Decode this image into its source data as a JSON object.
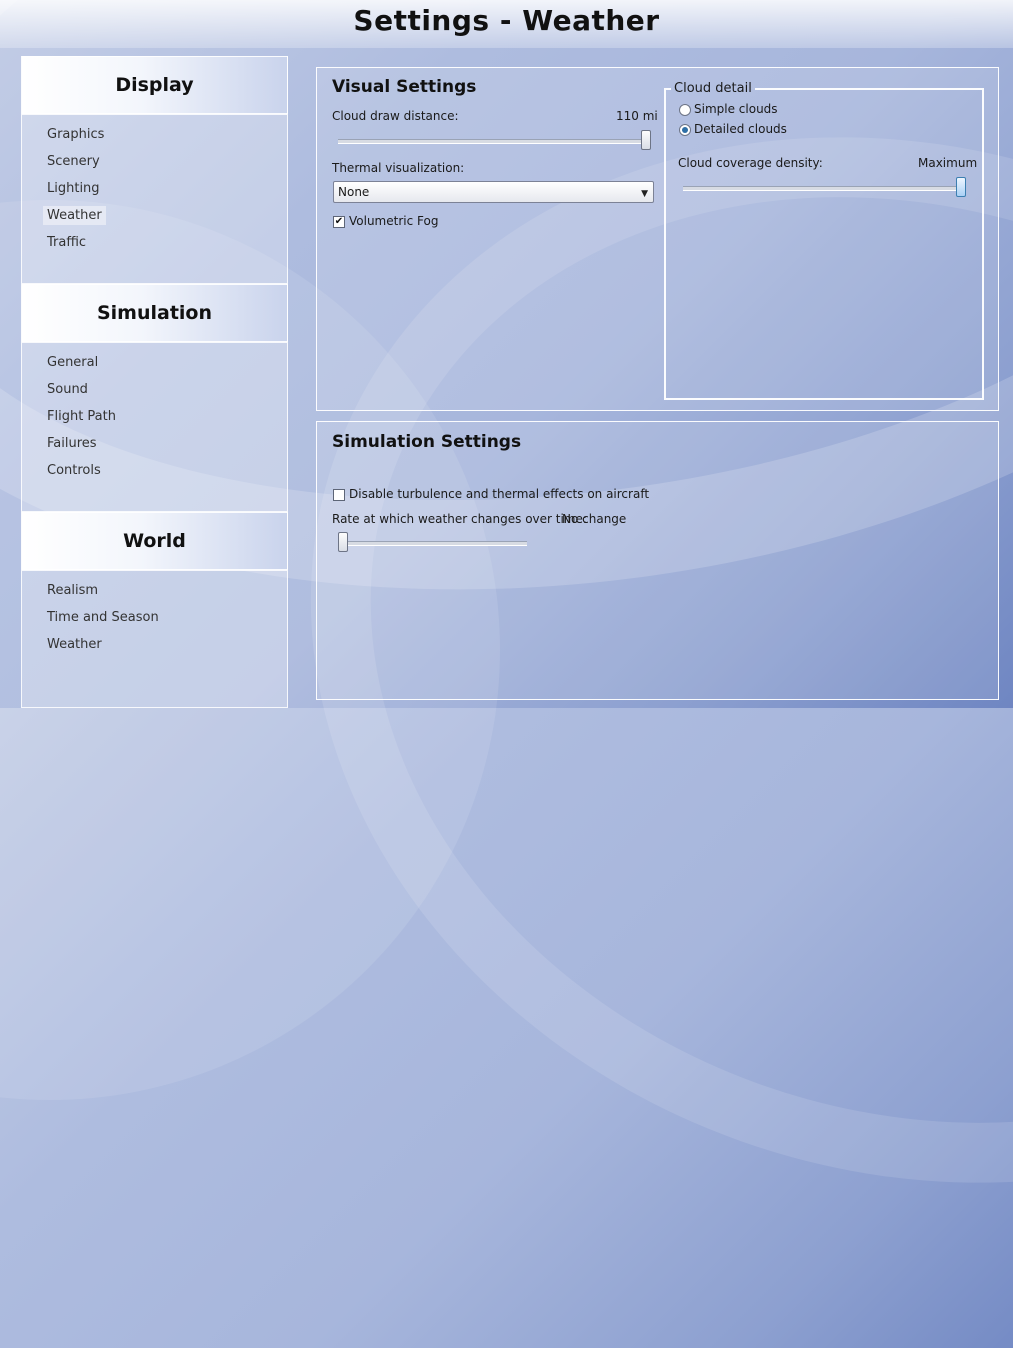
{
  "page": {
    "title": "Settings - Weather"
  },
  "nav": {
    "sections": [
      {
        "header": "Display",
        "items": [
          "Graphics",
          "Scenery",
          "Lighting",
          "Weather",
          "Traffic"
        ]
      },
      {
        "header": "Simulation",
        "items": [
          "General",
          "Sound",
          "Flight Path",
          "Failures",
          "Controls"
        ]
      },
      {
        "header": "World",
        "items": [
          "Realism",
          "Time and Season",
          "Weather"
        ]
      }
    ],
    "active": {
      "section": "Display",
      "item": "Weather"
    }
  },
  "visual": {
    "title": "Visual Settings",
    "cloud_draw_label": "Cloud draw distance:",
    "cloud_draw_value": "110 mi",
    "cloud_draw_level": 1.0,
    "thermal_label": "Thermal visualization:",
    "thermal_value": "None",
    "fog_label": "Volumetric Fog",
    "fog_checked": true,
    "cloud_detail": {
      "legend": "Cloud detail",
      "options": [
        "Simple clouds",
        "Detailed clouds"
      ],
      "selected": "Detailed clouds",
      "coverage_label": "Cloud coverage density:",
      "coverage_value": "Maximum",
      "coverage_level": 1.0
    }
  },
  "simulation": {
    "title": "Simulation Settings",
    "turbulence_label": "Disable turbulence and thermal effects on aircraft",
    "turbulence_checked": false,
    "rate_label": "Rate at which weather changes over time:",
    "rate_value": "No change",
    "rate_level": 0.0
  },
  "colors": {
    "accent_blue": "#2e6fa6",
    "background": "#a7b6dc"
  }
}
